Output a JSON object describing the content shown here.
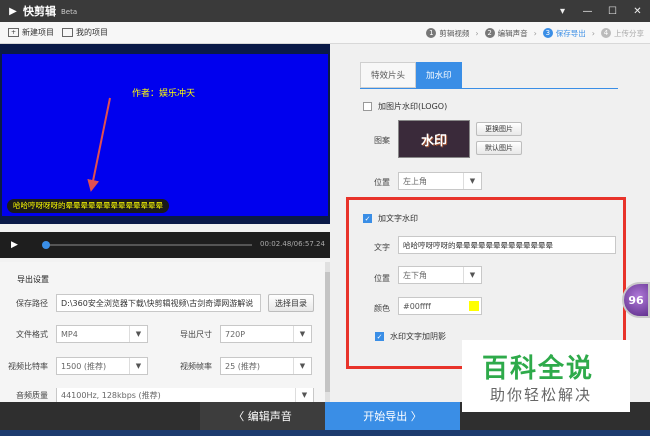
{
  "app": {
    "title": "快剪辑",
    "beta": "Beta"
  },
  "window_controls": {
    "menu": "▾",
    "minimize": "—",
    "maximize": "☐",
    "close": "✕"
  },
  "toolbar": {
    "new_project": "新建项目",
    "my_projects": "我的项目"
  },
  "steps": [
    {
      "num": "1",
      "label": "剪辑视频",
      "state": "done"
    },
    {
      "num": "2",
      "label": "编辑声音",
      "state": "done"
    },
    {
      "num": "3",
      "label": "保存导出",
      "state": "active"
    },
    {
      "num": "4",
      "label": "上传分享",
      "state": "disabled"
    }
  ],
  "video": {
    "center_watermark": "作者：娱乐冲天",
    "subtitle": "哈哈哼呀呀呀的晕晕晕晕晕晕晕晕晕晕晕晕晕"
  },
  "player": {
    "time": "00:02.48/06:57.24",
    "progress": 0.01
  },
  "export": {
    "title": "导出设置",
    "save_path_label": "保存路径",
    "save_path_value": "D:\\360安全浏览器下载\\快剪辑视频\\古剑奇谭网游解说",
    "choose_dir_button": "选择目录",
    "format_label": "文件格式",
    "format_value": "MP4",
    "size_label": "导出尺寸",
    "size_value": "720P",
    "bitrate_label": "视频比特率",
    "bitrate_value": "1500 (推荐)",
    "framerate_label": "视频帧率",
    "framerate_value": "25 (推荐)",
    "audio_label": "音频质量",
    "audio_value": "44100Hz, 128kbps (推荐)"
  },
  "tabs": {
    "special_intro": "特效片头",
    "watermark": "加水印"
  },
  "image_watermark": {
    "checkbox_label": "加图片水印(LOGO)",
    "checked": false,
    "pattern_label": "图案",
    "preview_text": "水印",
    "replace_button": "更换图片",
    "default_button": "默认图片",
    "position_label": "位置",
    "position_value": "左上角"
  },
  "text_watermark": {
    "checkbox_label": "加文字水印",
    "checked": true,
    "text_label": "文字",
    "text_value": "哈哈哼呀哼呀的晕晕晕晕晕晕晕晕晕晕晕晕晕",
    "position_label": "位置",
    "position_value": "左下角",
    "color_label": "颜色",
    "color_value": "#00ffff",
    "shadow_label": "水印文字加阴影",
    "shadow_checked": true
  },
  "bottom": {
    "prev_button": "〈 编辑声音",
    "next_button": "开始导出 〉"
  },
  "overlay": {
    "baike_big": "百科全说",
    "baike_small": "助你轻松解决",
    "badge": "96"
  },
  "colors": {
    "accent": "#3a8ee6",
    "highlight": "#e8332a",
    "swatch": "#ffff00"
  }
}
